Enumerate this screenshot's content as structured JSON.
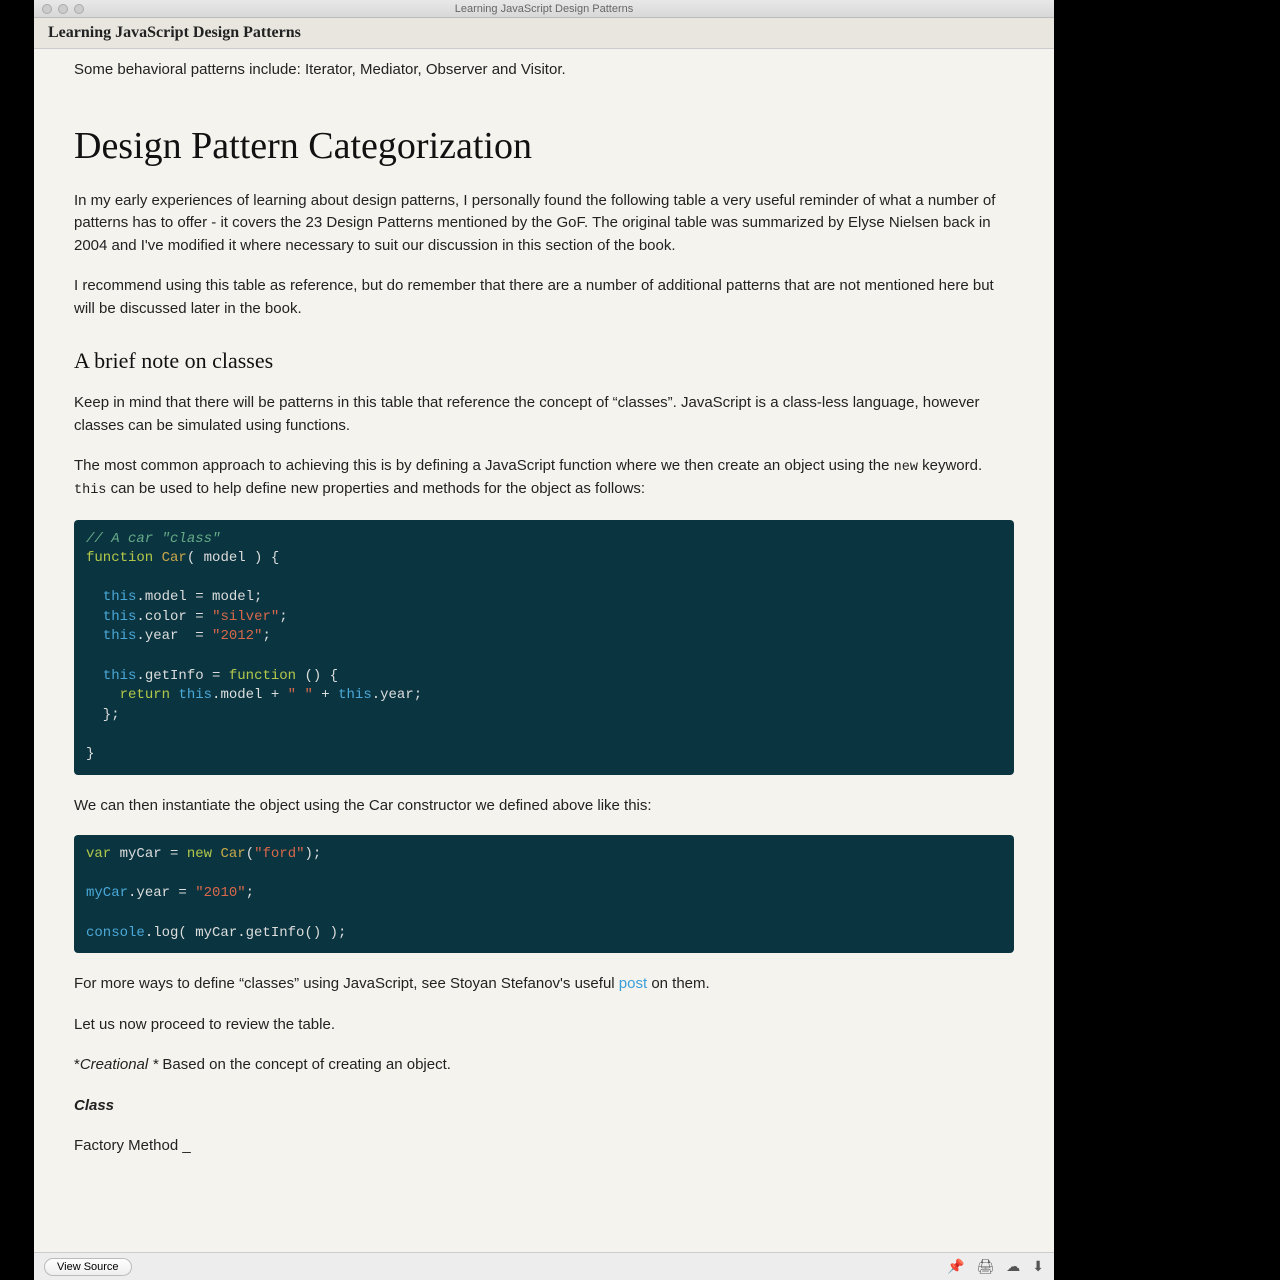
{
  "window": {
    "title": "Learning JavaScript Design Patterns"
  },
  "header": {
    "title": "Learning JavaScript Design Patterns"
  },
  "content": {
    "intro": "Some behavioral patterns include: Iterator, Mediator, Observer and Visitor.",
    "h1": "Design Pattern Categorization",
    "p1": "In my early experiences of learning about design patterns, I personally found the following table a very useful reminder of what a number of patterns has to offer - it covers the 23 Design Patterns mentioned by the GoF. The original table was summarized by Elyse Nielsen back in 2004 and I've modified it where necessary to suit our discussion in this section of the book.",
    "p2": "I recommend using this table as reference, but do remember that there are a number of additional patterns that are not men­tioned here but will be discussed later in the book.",
    "h2": "A brief note on classes",
    "p3": "Keep in mind that there will be patterns in this table that reference the concept of “classes”. JavaScript is a class-less language, however classes can be simulated using functions.",
    "p4a": "The most common approach to achieving this is by defining a JavaScript function where we then create an object using the ",
    "p4_code1": "new",
    "p4b": " keyword. ",
    "p4_code2": "this",
    "p4c": " can be used to help define new properties and methods for the object as follows:",
    "code1": {
      "c0": "// A car \"class\"",
      "kw0": "function",
      "cl0": "Car",
      "s0": "( model ) {",
      "th": "this",
      "dot": ".",
      "p_model": "model",
      "eq_model": " = model;",
      "p_color": "color",
      "eq": " = ",
      "str_silver": "\"silver\"",
      "semi": ";",
      "p_year": "year",
      "sp": "  = ",
      "str_2012": "\"2012\"",
      "p_getinfo": "getInfo",
      "eq2": " = ",
      "kw_fn": "function",
      "fn_tail": " () {",
      "kw_ret": "return",
      "ret_tail": ".model + ",
      "str_sp": "\" \"",
      "ret_tail2": " + ",
      "ret_tail3": ".year;",
      "close1": "  };",
      "close2": "}"
    },
    "p5": "We can then instantiate the object using the Car constructor we defined above like this:",
    "code2": {
      "kw_var": "var",
      "mycar": " myCar = ",
      "kw_new": "new",
      "sp": " ",
      "cl": "Car",
      "open": "(",
      "str_ford": "\"ford\"",
      "close": ");",
      "l2a": "myCar",
      "l2b": ".year = ",
      "str_2010": "\"2010\"",
      "l2c": ";",
      "l3a": "console",
      "l3b": ".log( myCar.getInfo() );"
    },
    "p6a": "For more ways to define “classes” using JavaScript, see Stoyan Stefanov's useful ",
    "p6_link": "post",
    "p6b": " on them.",
    "p7": "Let us now proceed to review the table.",
    "p8a": "*",
    "p8b": "Creational *",
    "p8c": " Based on the concept of creating an object.",
    "p9": "Class",
    "p10": "Factory Method _"
  },
  "footer": {
    "view_source": "View Source"
  },
  "icons": {
    "pin": "📌",
    "print": "🖨",
    "cloud": "☁",
    "download": "⬇"
  }
}
